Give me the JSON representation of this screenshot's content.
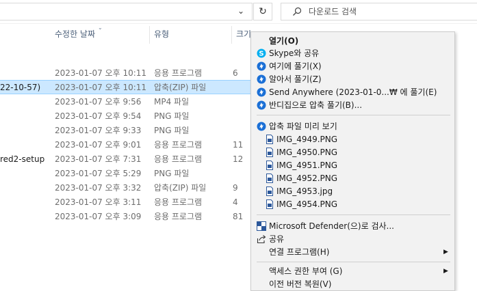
{
  "toolbar": {
    "address_chevron": "⌄",
    "refresh_glyph": "↻",
    "search_placeholder": "다운로드 검색"
  },
  "columns": {
    "date": "수정한 날짜",
    "type": "유형",
    "size": "크기"
  },
  "rows": [
    {
      "name": "",
      "date": "2023-01-07 오후 10:11",
      "type": "응용 프로그램",
      "size": "6"
    },
    {
      "name": "22-10-57)",
      "date": "2023-01-07 오후 10:11",
      "type": "압축(ZIP) 파일",
      "size": "",
      "selected": true
    },
    {
      "name": "",
      "date": "2023-01-07 오후 9:56",
      "type": "MP4 파일",
      "size": ""
    },
    {
      "name": "",
      "date": "2023-01-07 오후 9:54",
      "type": "PNG 파일",
      "size": ""
    },
    {
      "name": "",
      "date": "2023-01-07 오후 9:33",
      "type": "PNG 파일",
      "size": ""
    },
    {
      "name": "",
      "date": "2023-01-07 오후 9:01",
      "type": "응용 프로그램",
      "size": "11"
    },
    {
      "name": "red2-setup",
      "date": "2023-01-07 오후 7:31",
      "type": "응용 프로그램",
      "size": "12"
    },
    {
      "name": "",
      "date": "2023-01-07 오후 5:29",
      "type": "PNG 파일",
      "size": ""
    },
    {
      "name": "",
      "date": "2023-01-07 오후 3:32",
      "type": "압축(ZIP) 파일",
      "size": "9"
    },
    {
      "name": "",
      "date": "2023-01-07 오후 3:11",
      "type": "응용 프로그램",
      "size": "4"
    },
    {
      "name": "",
      "date": "2023-01-07 오후 3:09",
      "type": "응용 프로그램",
      "size": "81"
    }
  ],
  "menu": {
    "open": "열기(O)",
    "skype_share": "Skype와 공유",
    "extract_here": "여기에 풀기(X)",
    "extract_auto": "알아서 풀기(Z)",
    "extract_send": "Send Anywhere (2023-01-0...₩ 에 풀기(E)",
    "extract_bandizip": "반디집으로 압축 풀기(B)...",
    "preview": "압축 파일 미리 보기",
    "files": [
      "IMG_4949.PNG",
      "IMG_4950.PNG",
      "IMG_4951.PNG",
      "IMG_4952.PNG",
      "IMG_4953.jpg",
      "IMG_4954.PNG"
    ],
    "defender_scan": "Microsoft Defender(으)로 검사...",
    "share": "공유",
    "open_with": "연결 프로그램(H)",
    "give_access": "액세스 권한 부여 (G)",
    "restore_versions": "이전 버전 복원(V)"
  },
  "colors": {
    "selection_bg": "#cce8ff",
    "selection_border": "#99d1ff",
    "skype_blue": "#00aff0",
    "bandizip_blue": "#1a6fd6",
    "menu_bg": "#f2f2f2"
  }
}
